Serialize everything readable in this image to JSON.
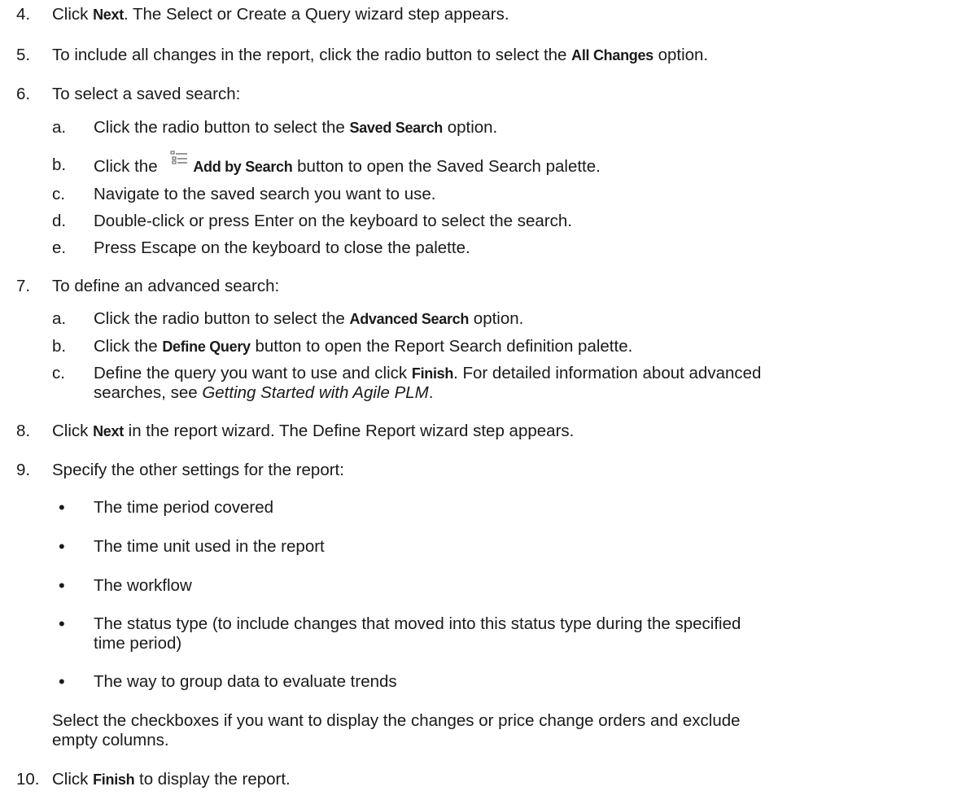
{
  "steps": [
    {
      "num": "4.",
      "pre": "Click ",
      "bold": "Next",
      "post": ". The Select or Create a Query wizard step appears."
    },
    {
      "num": "5.",
      "pre": "To include all changes in the report, click the radio button to select the ",
      "bold": "All Changes",
      "post": " option."
    },
    {
      "num": "6.",
      "text": "To select a saved search:"
    },
    {
      "num": "7.",
      "text": "To define an advanced search:"
    },
    {
      "num": "8.",
      "pre": "Click ",
      "bold": "Next",
      "post": " in the report wizard. The Define Report wizard step appears."
    },
    {
      "num": "9.",
      "text": "Specify the other settings for the report:"
    },
    {
      "num": "10.",
      "pre": "Click ",
      "bold": "Finish",
      "post": " to display the report."
    }
  ],
  "step6_sub": [
    {
      "letter": "a.",
      "pre": "Click the radio button to select the ",
      "bold": "Saved Search",
      "post": " option."
    },
    {
      "letter": "b.",
      "pre": "Click the ",
      "icon": "add-by-search-icon",
      "bold": "Add by Search",
      "post": " button to open the Saved Search palette."
    },
    {
      "letter": "c.",
      "text": "Navigate to the saved search you want to use."
    },
    {
      "letter": "d.",
      "text": "Double-click or press Enter on the keyboard to select the search."
    },
    {
      "letter": "e.",
      "text": "Press Escape on the keyboard to close the palette."
    }
  ],
  "step7_sub": [
    {
      "letter": "a.",
      "pre": "Click the radio button to select the ",
      "bold": "Advanced Search",
      "post": " option."
    },
    {
      "letter": "b.",
      "pre": "Click the ",
      "bold": "Define Query",
      "post": " button to open the Report Search definition palette."
    },
    {
      "letter": "c.",
      "pre": "Define the query you want to use and click ",
      "bold": "Finish",
      "post": ". For detailed information about advanced",
      "line2_pre": "searches, see ",
      "line2_italic": "Getting Started with Agile PLM",
      "line2_post": "."
    }
  ],
  "step9_bullets": [
    {
      "text": "The time period covered"
    },
    {
      "text": "The time unit used in the report"
    },
    {
      "text": "The workflow"
    },
    {
      "text": "The status type (to include changes that moved into this status type during the specified",
      "line2": "time period)"
    },
    {
      "text": "The way to group data to evaluate trends"
    }
  ],
  "step9_note": {
    "line1": "Select the checkboxes if you want to display the changes or price change orders and exclude",
    "line2": "empty columns."
  }
}
